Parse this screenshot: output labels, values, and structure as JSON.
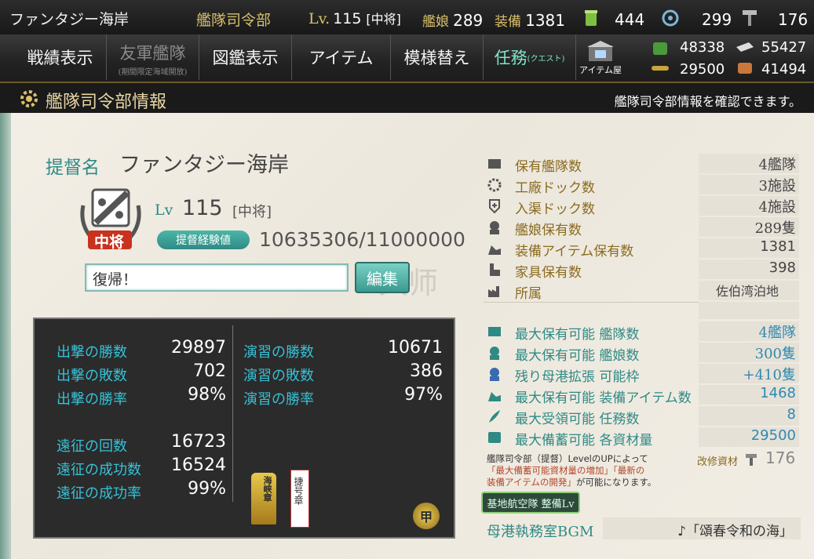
{
  "topbar": {
    "admiral_name": "ファンタジー海岸",
    "hq_label": "艦隊司令部",
    "hq_lv_prefix": "Lv.",
    "hq_level": "115",
    "hq_rank": "[中将]",
    "shipgirls_label": "艦娘",
    "shipgirls": "289",
    "equip_label": "装備",
    "equip": "1381",
    "bucket": "444",
    "devmat": "299",
    "screw": "176"
  },
  "nav": {
    "record": "戦績表示",
    "friend_fleet": "友軍艦隊",
    "friend_fleet_sub": "(期間限定海域開放)",
    "album": "図鑑表示",
    "items": "アイテム",
    "furniture": "模様替え",
    "quest": "任務",
    "quest_sub": "(クエスト)",
    "item_shop": "アイテム屋"
  },
  "resources": {
    "fuel": "48338",
    "steel": "55427",
    "ammo": "29500",
    "bauxite": "41494"
  },
  "header": {
    "title": "艦隊司令部情報",
    "description": "艦隊司令部情報を確認できます。"
  },
  "profile": {
    "admiral_label": "提督名",
    "admiral_name": "ファンタジー海岸",
    "lv_label": "Lv",
    "level": "115",
    "rank": "[中将]",
    "rank_badge": "中将",
    "exp_label": "提督経験値",
    "exp": "10635306/11000000",
    "comment": "復帰！",
    "edit_button": "編集"
  },
  "stats": {
    "sortie_win_label": "出撃の勝数",
    "sortie_win": "29897",
    "sortie_lose_label": "出撃の敗数",
    "sortie_lose": "702",
    "sortie_rate_label": "出撃の勝率",
    "sortie_rate": "98%",
    "exercise_win_label": "演習の勝数",
    "exercise_win": "10671",
    "exercise_lose_label": "演習の敗数",
    "exercise_lose": "386",
    "exercise_rate_label": "演習の勝率",
    "exercise_rate": "97%",
    "expedition_count_label": "遠征の回数",
    "expedition_count": "16723",
    "expedition_success_label": "遠征の成功数",
    "expedition_success": "16524",
    "expedition_rate_label": "遠征の成功率",
    "expedition_rate": "99%",
    "medal1": "海峡章",
    "medal2": "捷号章",
    "medal3": "甲"
  },
  "table": {
    "fleets_label": "保有艦隊数",
    "fleets": "4艦隊",
    "dock_label": "工廠ドック数",
    "dock": "3施設",
    "repair_label": "入渠ドック数",
    "repair": "4施設",
    "ships_label": "艦娘保有数",
    "ships": "289隻",
    "equip_label": "装備アイテム保有数",
    "equip": "1381",
    "furniture_label": "家具保有数",
    "furniture": "398",
    "affiliation_label": "所属",
    "affiliation": "佐伯湾泊地",
    "max_fleets_label": "最大保有可能 艦隊数",
    "max_fleets": "4艦隊",
    "max_ships_label": "最大保有可能 艦娘数",
    "max_ships": "300隻",
    "expand_label": "残り母港拡張 可能枠",
    "expand": "+410隻",
    "max_equip_label": "最大保有可能 装備アイテム数",
    "max_equip": "1468",
    "max_quest_label": "最大受領可能 任務数",
    "max_quest": "8",
    "max_res_label": "最大備蓄可能 各資材量",
    "max_res": "29500"
  },
  "note": {
    "line1": "艦隊司令部（提督）LevelのUPによって",
    "line2": "「最大備蓄可能資材量の増加」「最新の",
    "line3": "装備アイテムの開発」",
    "line3b": "が可能になります。",
    "kaishu_label": "改修資材",
    "kaishu": "176"
  },
  "base_button": "基地航空隊 整備Lv",
  "bgm": {
    "label": "母港執務室BGM",
    "value": "♪「頌春令和の海」"
  },
  "watermark": "大师"
}
